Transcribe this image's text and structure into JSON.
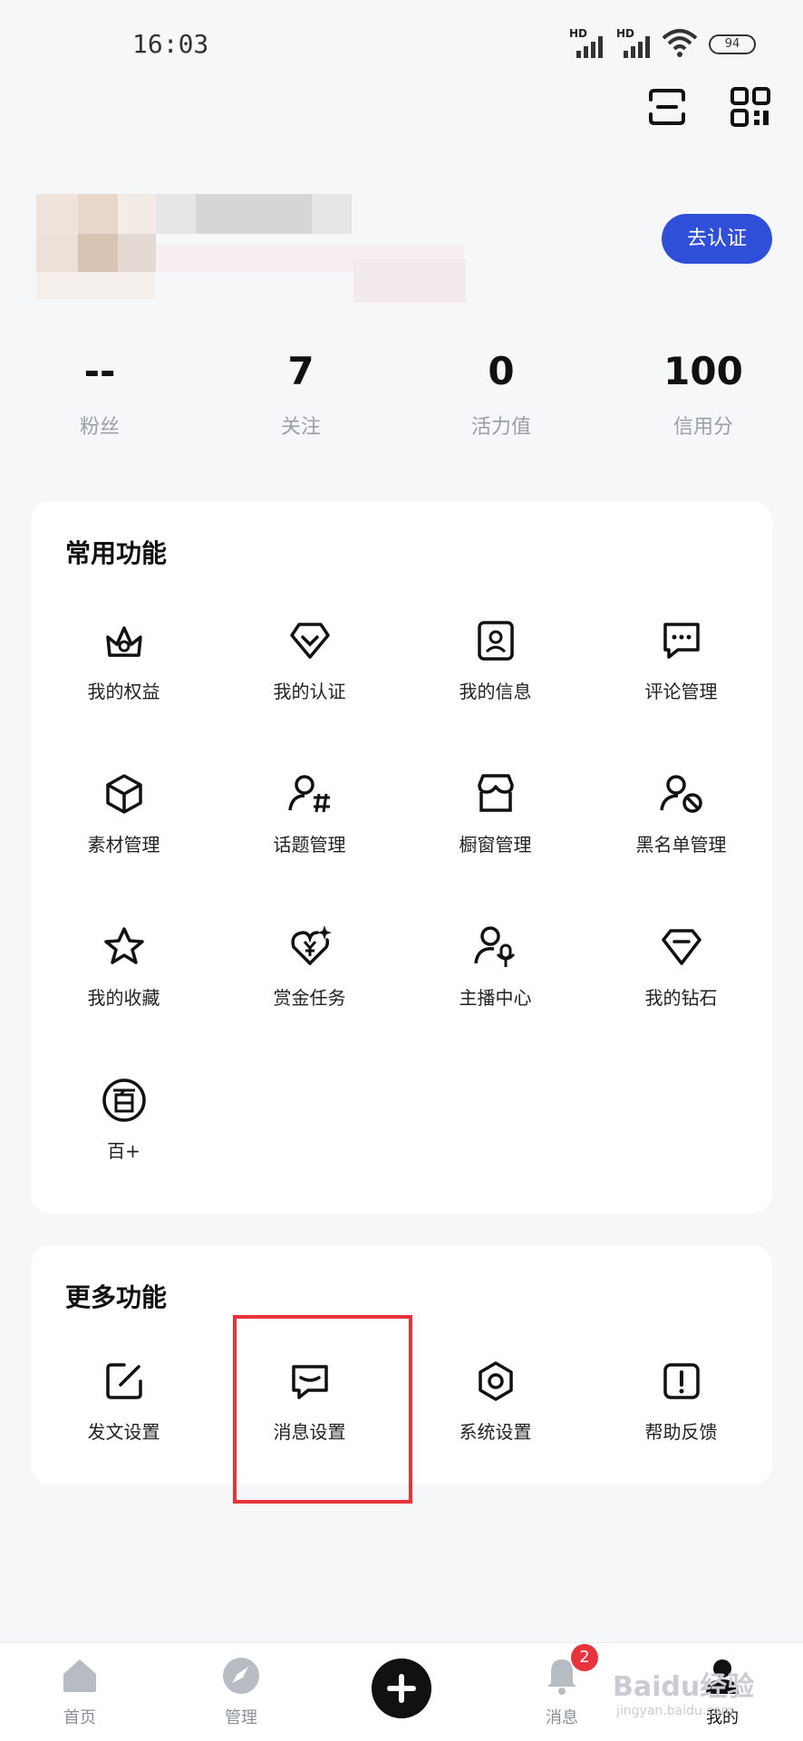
{
  "status": {
    "time": "16:03",
    "hd": "HD",
    "battery": "94"
  },
  "profile": {
    "certify_button": "去认证"
  },
  "stats": [
    {
      "value": "--",
      "label": "粉丝"
    },
    {
      "value": "7",
      "label": "关注"
    },
    {
      "value": "0",
      "label": "活力值"
    },
    {
      "value": "100",
      "label": "信用分"
    }
  ],
  "common": {
    "title": "常用功能",
    "items": [
      {
        "label": "我的权益",
        "icon": "crown-icon"
      },
      {
        "label": "我的认证",
        "icon": "verified-badge-icon"
      },
      {
        "label": "我的信息",
        "icon": "profile-card-icon"
      },
      {
        "label": "评论管理",
        "icon": "comment-icon"
      },
      {
        "label": "素材管理",
        "icon": "cube-icon"
      },
      {
        "label": "话题管理",
        "icon": "user-hashtag-icon"
      },
      {
        "label": "橱窗管理",
        "icon": "shop-icon"
      },
      {
        "label": "黑名单管理",
        "icon": "user-block-icon"
      },
      {
        "label": "我的收藏",
        "icon": "star-icon"
      },
      {
        "label": "赏金任务",
        "icon": "bounty-icon"
      },
      {
        "label": "主播中心",
        "icon": "user-mic-icon"
      },
      {
        "label": "我的钻石",
        "icon": "diamond-icon"
      },
      {
        "label": "百+",
        "icon": "bai-icon"
      }
    ]
  },
  "more": {
    "title": "更多功能",
    "items": [
      {
        "label": "发文设置",
        "icon": "edit-icon"
      },
      {
        "label": "消息设置",
        "icon": "message-icon"
      },
      {
        "label": "系统设置",
        "icon": "settings-icon"
      },
      {
        "label": "帮助反馈",
        "icon": "help-icon"
      }
    ]
  },
  "tabbar": {
    "home": "首页",
    "manage": "管理",
    "messages": "消息",
    "messages_badge": "2",
    "mine": "我的"
  },
  "watermark": {
    "brand": "Baidu经验",
    "url": "jingyan.baidu.com"
  }
}
